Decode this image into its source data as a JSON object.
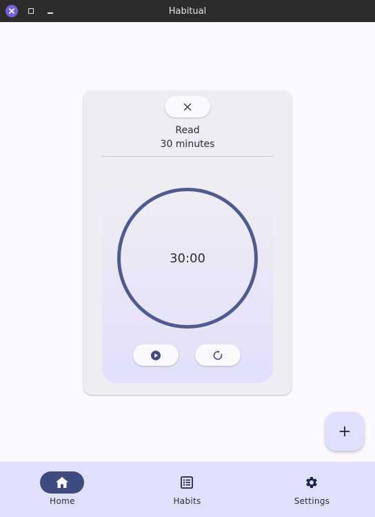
{
  "window": {
    "title": "Habitual"
  },
  "habit": {
    "name": "Read",
    "goal": "30 minutes"
  },
  "timer": {
    "display": "30:00"
  },
  "icons": {
    "close": "close-icon",
    "play": "play-circle-icon",
    "reset": "refresh-icon",
    "add": "plus-icon"
  },
  "nav": {
    "items": [
      {
        "label": "Home",
        "icon": "home-icon",
        "active": true
      },
      {
        "label": "Habits",
        "icon": "list-icon",
        "active": false
      },
      {
        "label": "Settings",
        "icon": "gear-icon",
        "active": false
      }
    ]
  },
  "colors": {
    "accent": "#4f5a8f",
    "active_nav": "#3f4a80",
    "nav_background": "#dfe0fb",
    "titlebar": "#2c2c2c"
  }
}
